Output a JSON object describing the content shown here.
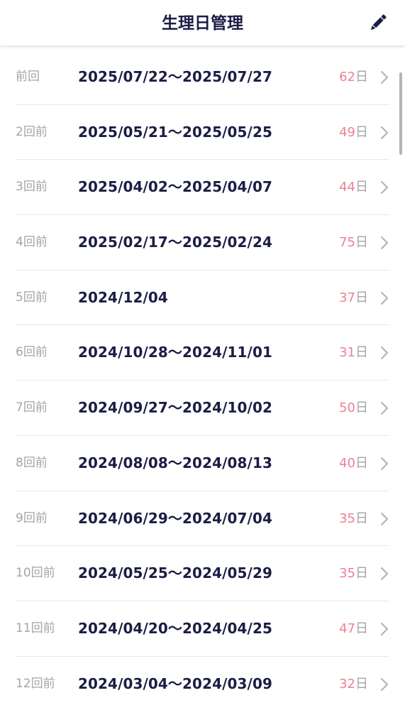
{
  "header": {
    "title": "生理日管理",
    "edit_icon": "pencil-icon"
  },
  "colors": {
    "title": "#1b1d45",
    "accent_pink": "#ef7f95",
    "muted": "#a4a4aa"
  },
  "records": [
    {
      "label": "前回",
      "dates": "2025/07/22〜2025/07/27",
      "cycle": "62",
      "unit": "日"
    },
    {
      "label": "2回前",
      "dates": "2025/05/21〜2025/05/25",
      "cycle": "49",
      "unit": "日"
    },
    {
      "label": "3回前",
      "dates": "2025/04/02〜2025/04/07",
      "cycle": "44",
      "unit": "日"
    },
    {
      "label": "4回前",
      "dates": "2025/02/17〜2025/02/24",
      "cycle": "75",
      "unit": "日"
    },
    {
      "label": "5回前",
      "dates": "2024/12/04",
      "cycle": "37",
      "unit": "日"
    },
    {
      "label": "6回前",
      "dates": "2024/10/28〜2024/11/01",
      "cycle": "31",
      "unit": "日"
    },
    {
      "label": "7回前",
      "dates": "2024/09/27〜2024/10/02",
      "cycle": "50",
      "unit": "日"
    },
    {
      "label": "8回前",
      "dates": "2024/08/08〜2024/08/13",
      "cycle": "40",
      "unit": "日"
    },
    {
      "label": "9回前",
      "dates": "2024/06/29〜2024/07/04",
      "cycle": "35",
      "unit": "日"
    },
    {
      "label": "10回前",
      "dates": "2024/05/25〜2024/05/29",
      "cycle": "35",
      "unit": "日"
    },
    {
      "label": "11回前",
      "dates": "2024/04/20〜2024/04/25",
      "cycle": "47",
      "unit": "日"
    },
    {
      "label": "12回前",
      "dates": "2024/03/04〜2024/03/09",
      "cycle": "32",
      "unit": "日"
    }
  ]
}
